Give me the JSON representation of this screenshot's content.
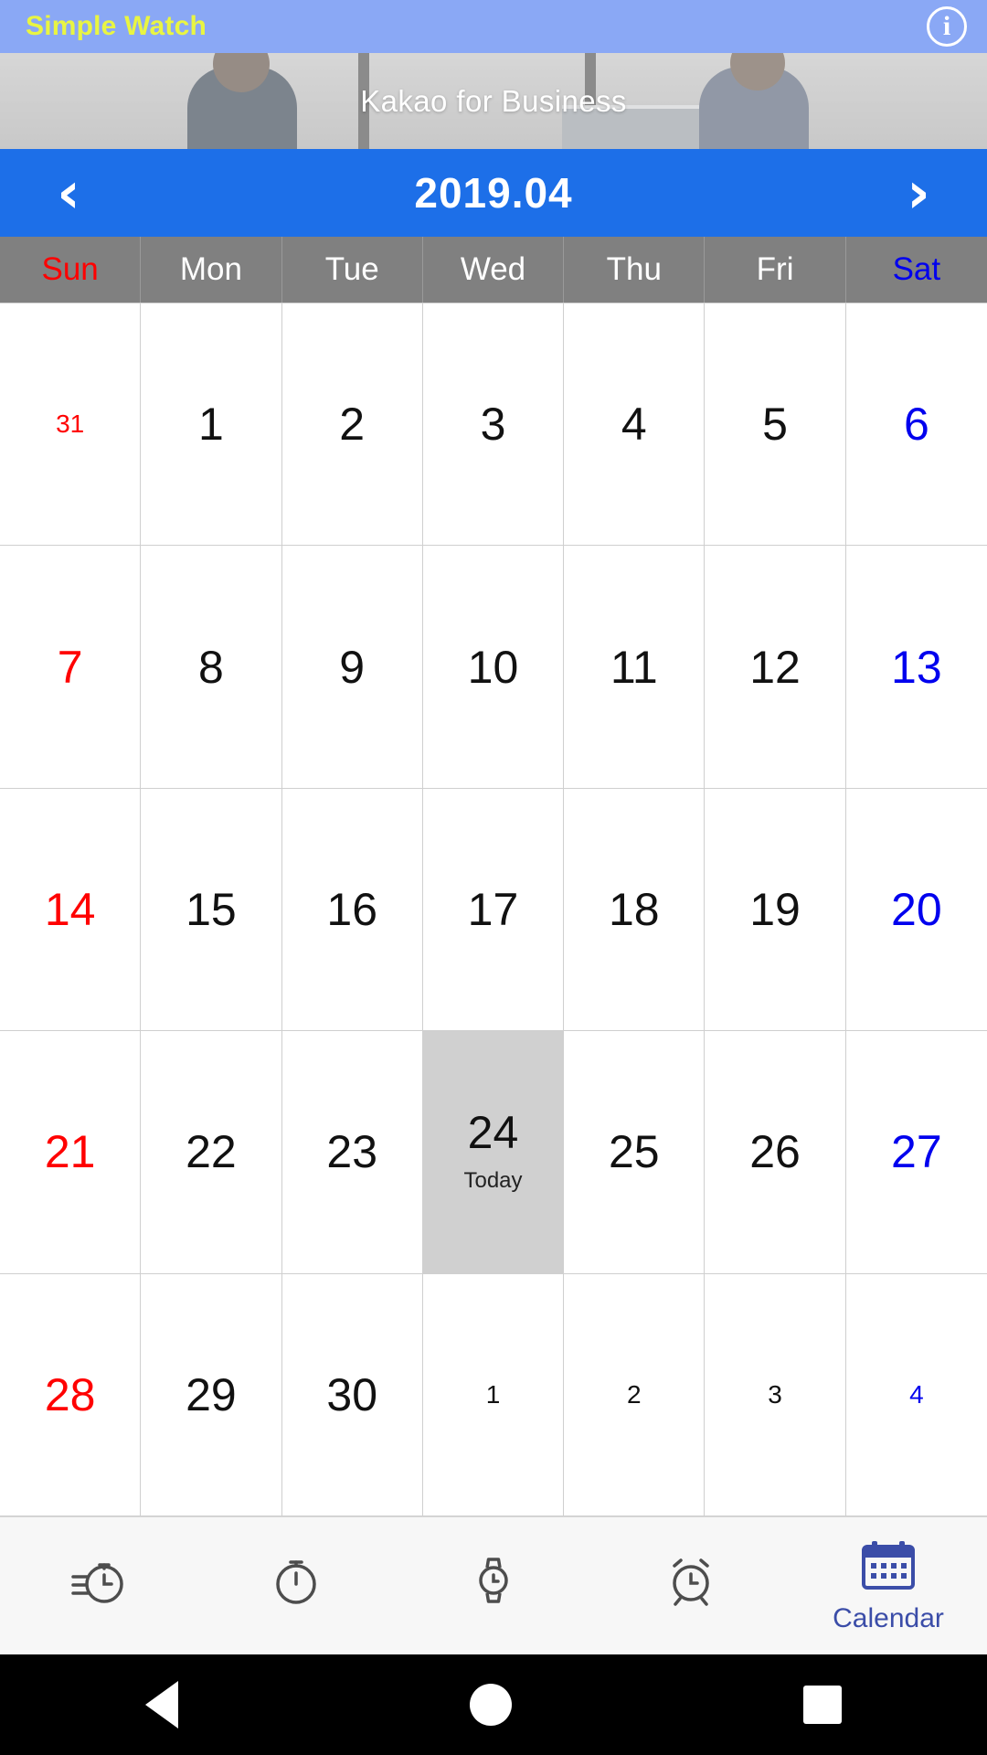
{
  "titlebar": {
    "app_title": "Simple Watch",
    "info_icon": "info-icon",
    "bg_color": "#8aa8f5",
    "title_color": "#e9f542"
  },
  "ad": {
    "text": "Kakao for Business"
  },
  "month_bar": {
    "prev_label": "‹",
    "next_label": "›",
    "title": "2019.04",
    "bg_color": "#1d6fe8"
  },
  "weekdays": [
    {
      "label": "Sun",
      "kind": "sun"
    },
    {
      "label": "Mon",
      "kind": "mid"
    },
    {
      "label": "Tue",
      "kind": "mid"
    },
    {
      "label": "Wed",
      "kind": "mid"
    },
    {
      "label": "Thu",
      "kind": "mid"
    },
    {
      "label": "Fri",
      "kind": "mid"
    },
    {
      "label": "Sat",
      "kind": "sat"
    }
  ],
  "today_label": "Today",
  "colors": {
    "sunday": "#ff0000",
    "saturday": "#0000ee",
    "weekday": "#111111",
    "today_bg": "#d0d0d0",
    "header_bg": "#808080"
  },
  "days": [
    {
      "n": "31",
      "kind": "sun",
      "other": true,
      "today": false
    },
    {
      "n": "1",
      "kind": "mid",
      "other": false,
      "today": false
    },
    {
      "n": "2",
      "kind": "mid",
      "other": false,
      "today": false
    },
    {
      "n": "3",
      "kind": "mid",
      "other": false,
      "today": false
    },
    {
      "n": "4",
      "kind": "mid",
      "other": false,
      "today": false
    },
    {
      "n": "5",
      "kind": "mid",
      "other": false,
      "today": false
    },
    {
      "n": "6",
      "kind": "sat",
      "other": false,
      "today": false
    },
    {
      "n": "7",
      "kind": "sun",
      "other": false,
      "today": false
    },
    {
      "n": "8",
      "kind": "mid",
      "other": false,
      "today": false
    },
    {
      "n": "9",
      "kind": "mid",
      "other": false,
      "today": false
    },
    {
      "n": "10",
      "kind": "mid",
      "other": false,
      "today": false
    },
    {
      "n": "11",
      "kind": "mid",
      "other": false,
      "today": false
    },
    {
      "n": "12",
      "kind": "mid",
      "other": false,
      "today": false
    },
    {
      "n": "13",
      "kind": "sat",
      "other": false,
      "today": false
    },
    {
      "n": "14",
      "kind": "sun",
      "other": false,
      "today": false
    },
    {
      "n": "15",
      "kind": "mid",
      "other": false,
      "today": false
    },
    {
      "n": "16",
      "kind": "mid",
      "other": false,
      "today": false
    },
    {
      "n": "17",
      "kind": "mid",
      "other": false,
      "today": false
    },
    {
      "n": "18",
      "kind": "mid",
      "other": false,
      "today": false
    },
    {
      "n": "19",
      "kind": "mid",
      "other": false,
      "today": false
    },
    {
      "n": "20",
      "kind": "sat",
      "other": false,
      "today": false
    },
    {
      "n": "21",
      "kind": "sun",
      "other": false,
      "today": false
    },
    {
      "n": "22",
      "kind": "mid",
      "other": false,
      "today": false
    },
    {
      "n": "23",
      "kind": "mid",
      "other": false,
      "today": false
    },
    {
      "n": "24",
      "kind": "mid",
      "other": false,
      "today": true
    },
    {
      "n": "25",
      "kind": "mid",
      "other": false,
      "today": false
    },
    {
      "n": "26",
      "kind": "mid",
      "other": false,
      "today": false
    },
    {
      "n": "27",
      "kind": "sat",
      "other": false,
      "today": false
    },
    {
      "n": "28",
      "kind": "sun",
      "other": false,
      "today": false
    },
    {
      "n": "29",
      "kind": "mid",
      "other": false,
      "today": false
    },
    {
      "n": "30",
      "kind": "mid",
      "other": false,
      "today": false
    },
    {
      "n": "1",
      "kind": "mid",
      "other": true,
      "today": false
    },
    {
      "n": "2",
      "kind": "mid",
      "other": true,
      "today": false
    },
    {
      "n": "3",
      "kind": "mid",
      "other": true,
      "today": false
    },
    {
      "n": "4",
      "kind": "sat",
      "other": true,
      "today": false
    }
  ],
  "tabs": [
    {
      "icon": "stopwatch-lap-icon",
      "label": "",
      "active": false
    },
    {
      "icon": "stopwatch-icon",
      "label": "",
      "active": false
    },
    {
      "icon": "watch-icon",
      "label": "",
      "active": false
    },
    {
      "icon": "alarm-clock-icon",
      "label": "",
      "active": false
    },
    {
      "icon": "calendar-icon",
      "label": "Calendar",
      "active": true
    }
  ],
  "navbar": {
    "back": "back-triangle-icon",
    "home": "home-circle-icon",
    "recents": "recents-square-icon"
  }
}
